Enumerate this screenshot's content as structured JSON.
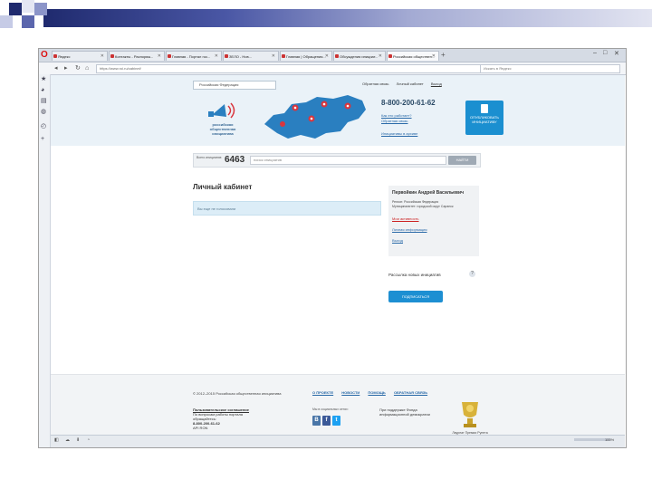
{
  "browser": {
    "tabs": [
      {
        "label": "Яндекс"
      },
      {
        "label": "Контакты - Распоряж..."
      },
      {
        "label": "Главная - Портал гос..."
      },
      {
        "label": "ЗЕЛО - Нов..."
      },
      {
        "label": "Главная | Обращения..."
      },
      {
        "label": "Обсуждения инициат..."
      },
      {
        "label": "Российская обществен..."
      }
    ],
    "new_tab": "+",
    "url": "https://www.roi.ru/cabinet/",
    "search_placeholder": "Искать в Яндекс",
    "back": "◂",
    "forward": "▸",
    "reload": "↻",
    "home": "⌂",
    "window_controls": [
      "–",
      "□",
      "✕"
    ]
  },
  "sidebar": {
    "icons": [
      "★",
      "◕",
      "▤",
      "◍",
      "◴",
      "+"
    ]
  },
  "header": {
    "region_select": "Российская Федерация",
    "feedback_link": "Обратная связь",
    "cabinet_link": "Личный кабинет",
    "logout_link": "Выход",
    "logo_text": "российская общественная инициатива",
    "phone": "8-800-200-61-62",
    "link_how": "Как это работает?",
    "link_contacts": "Обратная связь",
    "link_archive": "Инициативы в архиве",
    "publish_button": "ОПУБЛИКОВАТЬ ИНИЦИАТИВУ"
  },
  "search": {
    "total_label": "Всего инициатив:",
    "count": "6463",
    "placeholder": "поиск инициатив",
    "button": "НАЙТИ"
  },
  "cabinet": {
    "title": "Личный кабинет",
    "notice": "Вы еще не голосовали"
  },
  "profile": {
    "name": "Первойкин Андрей Васильевич",
    "line1": "Регион: Российская Федерация",
    "line2": "Муниципалитет: городской округ Саранск",
    "my_activity": "Мои активность",
    "personal_info": "Личная информация",
    "logout": "Выход"
  },
  "mailing": {
    "label": "Рассылка новых инициатив",
    "help": "?",
    "button": "ПОДПИСАТЬСЯ"
  },
  "footer": {
    "copyright": "© 2012–2015 Российская общественная инициатива",
    "nav": [
      "О ПРОЕКТЕ",
      "НОВОСТИ",
      "ПОМОЩЬ",
      "ОБРАТНАЯ СВЯЗЬ"
    ],
    "agreement_title": "Пользовательское соглашение",
    "agreement_line": "По вопросам работы портала обращайтесь:",
    "agreement_phone": "8-800-200-61-62",
    "agreement_mail": "АРI RON",
    "social_label": "Мы в социальных сетях:",
    "social": [
      "В",
      "f",
      "t"
    ],
    "support_text": "При поддержке Фонда информационной демократии",
    "award_text": "Лауреат Премии Рунета 2013"
  },
  "status": {
    "icons": [
      "◧",
      "☁",
      "⬇",
      "◔"
    ],
    "zoom": "100%"
  },
  "colors": {
    "accent_blue": "#1b8fd0",
    "header_bg": "#eaf2f8",
    "map_blue": "#2a7fc0",
    "pin_red": "#d9363e",
    "deco_dark": "#1f2a6e"
  }
}
